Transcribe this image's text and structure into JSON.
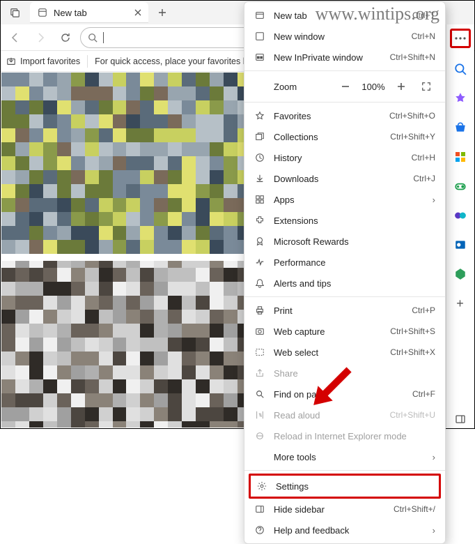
{
  "watermark": "www.wintips.org",
  "tabstrip": {
    "tabs": [
      {
        "title": "New tab"
      }
    ]
  },
  "bookmarks": {
    "import_label": "Import favorites",
    "hint": "For quick access, place your favorites here on the favorites b"
  },
  "menu_trigger_tooltip": "Settings and more",
  "zoom": {
    "label": "Zoom",
    "value": "100%"
  },
  "menu": {
    "new_tab": {
      "label": "New tab",
      "shortcut": "Ctrl+T"
    },
    "new_window": {
      "label": "New window",
      "shortcut": "Ctrl+N"
    },
    "new_inprivate": {
      "label": "New InPrivate window",
      "shortcut": "Ctrl+Shift+N"
    },
    "favorites": {
      "label": "Favorites",
      "shortcut": "Ctrl+Shift+O"
    },
    "collections": {
      "label": "Collections",
      "shortcut": "Ctrl+Shift+Y"
    },
    "history": {
      "label": "History",
      "shortcut": "Ctrl+H"
    },
    "downloads": {
      "label": "Downloads",
      "shortcut": "Ctrl+J"
    },
    "apps": {
      "label": "Apps"
    },
    "extensions": {
      "label": "Extensions"
    },
    "rewards": {
      "label": "Microsoft Rewards"
    },
    "performance": {
      "label": "Performance"
    },
    "alerts": {
      "label": "Alerts and tips"
    },
    "print": {
      "label": "Print",
      "shortcut": "Ctrl+P"
    },
    "web_capture": {
      "label": "Web capture",
      "shortcut": "Ctrl+Shift+S"
    },
    "web_select": {
      "label": "Web select",
      "shortcut": "Ctrl+Shift+X"
    },
    "share": {
      "label": "Share"
    },
    "find": {
      "label": "Find on page",
      "shortcut": "Ctrl+F"
    },
    "read_aloud": {
      "label": "Read aloud",
      "shortcut": "Ctrl+Shift+U"
    },
    "reload_ie": {
      "label": "Reload in Internet Explorer mode"
    },
    "more_tools": {
      "label": "More tools"
    },
    "settings": {
      "label": "Settings"
    },
    "hide_sidebar": {
      "label": "Hide sidebar",
      "shortcut": "Ctrl+Shift+/"
    },
    "help": {
      "label": "Help and feedback"
    }
  },
  "sidebar": {
    "items": [
      "search",
      "copilot",
      "shopping",
      "tools",
      "games",
      "office",
      "outlook",
      "onenote"
    ],
    "add_label": "+"
  }
}
